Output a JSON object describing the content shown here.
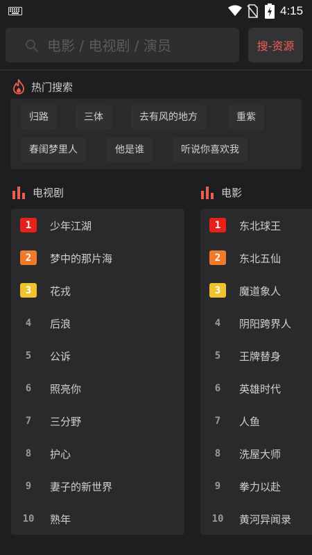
{
  "status_bar": {
    "time": "4:15",
    "icons": [
      "keyboard-icon",
      "wifi-icon",
      "no-sim-icon",
      "battery-charging-icon"
    ]
  },
  "search": {
    "placeholder": "电影 / 电视剧 / 演员",
    "button_label": "搜-资源"
  },
  "hot_search": {
    "title": "热门搜索",
    "tags": [
      "归路",
      "三体",
      "去有风的地方",
      "重紫",
      "春闺梦里人",
      "他是谁",
      "听说你喜欢我"
    ]
  },
  "tv_ranking": {
    "title": "电视剧",
    "items": [
      {
        "rank": "1",
        "title": "少年江湖"
      },
      {
        "rank": "2",
        "title": "梦中的那片海"
      },
      {
        "rank": "3",
        "title": "花戎"
      },
      {
        "rank": "4",
        "title": "后浪"
      },
      {
        "rank": "5",
        "title": "公诉"
      },
      {
        "rank": "6",
        "title": "照亮你"
      },
      {
        "rank": "7",
        "title": "三分野"
      },
      {
        "rank": "8",
        "title": "护心"
      },
      {
        "rank": "9",
        "title": "妻子的新世界"
      },
      {
        "rank": "10",
        "title": "熟年"
      }
    ]
  },
  "movie_ranking": {
    "title": "电影",
    "items": [
      {
        "rank": "1",
        "title": "东北球王"
      },
      {
        "rank": "2",
        "title": "东北五仙"
      },
      {
        "rank": "3",
        "title": "魔道象人"
      },
      {
        "rank": "4",
        "title": "阴阳跨界人"
      },
      {
        "rank": "5",
        "title": "王牌替身"
      },
      {
        "rank": "6",
        "title": "英雄时代"
      },
      {
        "rank": "7",
        "title": "人鱼"
      },
      {
        "rank": "8",
        "title": "洗屋大师"
      },
      {
        "rank": "9",
        "title": "拳力以赴"
      },
      {
        "rank": "10",
        "title": "黄河异闻录"
      }
    ]
  },
  "colors": {
    "background": "#1e1e20",
    "panel": "#2a2a2c",
    "accent": "#ef5f50",
    "rank1": "#e8201a",
    "rank2": "#f07a2a",
    "rank3": "#f2c12e"
  }
}
